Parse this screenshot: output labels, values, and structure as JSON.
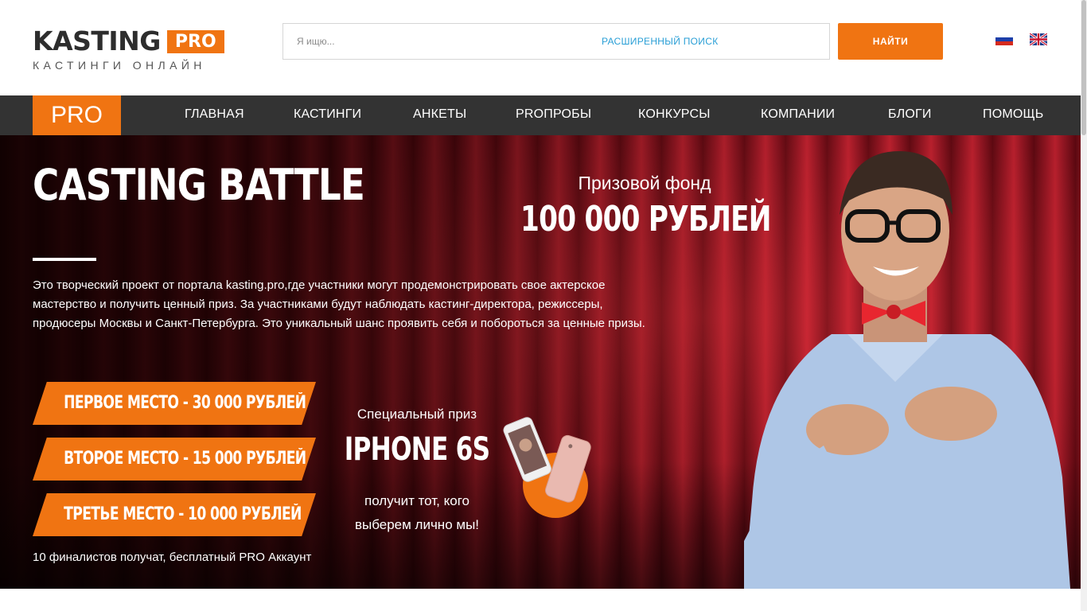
{
  "header": {
    "logo_main": "KASTING",
    "logo_badge": "PRO",
    "logo_tagline": "КАСТИНГИ ОНЛАЙН",
    "search_placeholder": "Я ищю...",
    "advanced_search": "РАСШИРЕННЫЙ ПОИСК",
    "find_button": "НАЙТИ",
    "flags": [
      "flag-ru-icon",
      "flag-gb-icon"
    ]
  },
  "nav": {
    "pro_label": "PRO",
    "items": [
      "ГЛАВНАЯ",
      "КАСТИНГИ",
      "АНКЕТЫ",
      "PROПРОБЫ",
      "КОНКУРСЫ",
      "КОМПАНИИ",
      "БЛОГИ",
      "ПОМОЩЬ"
    ]
  },
  "hero": {
    "title": "CASTING BATTLE",
    "description": "Это творческий проект от портала kasting.pro,где участники могут продемонстрировать свое актерское мастерство и получить ценный приз. За участниками будут наблюдать кастинг-директора, режиссеры, продюсеры Москвы и Санкт-Петербурга. Это уникальный шанс проявить себя и побороться за ценные призы.",
    "prize_label": "Призовой фонд",
    "prize_amount": "100 000 РУБЛЕЙ",
    "places": [
      "ПЕРВОЕ МЕСТО - 30 000 РУБЛЕЙ",
      "ВТОРОЕ МЕСТО - 15 000 РУБЛЕЙ",
      "ТРЕТЬЕ МЕСТО - 10 000 РУБЛЕЙ"
    ],
    "finalists": "10 финалистов получат, бесплатный PRO Аккаунт",
    "special_label": "Специальный приз",
    "special_name": "IPHONE 6S",
    "special_note_1": "получит тот, кого",
    "special_note_2": "выберем лично мы!"
  },
  "colors": {
    "accent": "#f07412",
    "nav_bg": "#333333",
    "link": "#2a9fd6",
    "curtain": "#a51a28"
  }
}
